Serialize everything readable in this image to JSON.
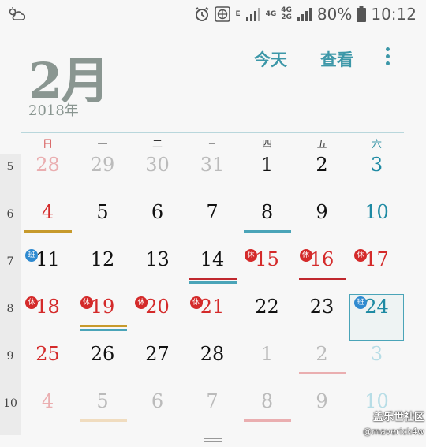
{
  "status_bar": {
    "network_e": "E",
    "network_4g": "4G",
    "network_4g_2g_top": "4G",
    "network_4g_2g_bottom": "2G",
    "battery": "80%",
    "time": "10:12"
  },
  "header": {
    "month": "2月",
    "year": "2018年",
    "today_button": "今天",
    "view_button": "查看"
  },
  "weekdays": [
    "日",
    "一",
    "二",
    "三",
    "四",
    "五",
    "六"
  ],
  "week_numbers": [
    "5",
    "6",
    "7",
    "8",
    "9",
    "10"
  ],
  "weeks": [
    [
      {
        "d": "28",
        "c": "pink"
      },
      {
        "d": "29",
        "c": "dim"
      },
      {
        "d": "30",
        "c": "dim"
      },
      {
        "d": "31",
        "c": "dim"
      },
      {
        "d": "1",
        "c": "normal"
      },
      {
        "d": "2",
        "c": "normal"
      },
      {
        "d": "3",
        "c": "sat"
      }
    ],
    [
      {
        "d": "4",
        "c": "holiday",
        "u": [
          "#c79a2c"
        ]
      },
      {
        "d": "5",
        "c": "normal"
      },
      {
        "d": "6",
        "c": "normal"
      },
      {
        "d": "7",
        "c": "normal"
      },
      {
        "d": "8",
        "c": "normal",
        "u": [
          "#4aa4b8"
        ]
      },
      {
        "d": "9",
        "c": "normal"
      },
      {
        "d": "10",
        "c": "sat"
      }
    ],
    [
      {
        "d": "11",
        "c": "normal",
        "b": "班",
        "bt": "work"
      },
      {
        "d": "12",
        "c": "normal"
      },
      {
        "d": "13",
        "c": "normal"
      },
      {
        "d": "14",
        "c": "normal",
        "u": [
          "#c0282e",
          "#4aa4b8"
        ]
      },
      {
        "d": "15",
        "c": "holiday",
        "b": "休",
        "bt": "rest"
      },
      {
        "d": "16",
        "c": "holiday",
        "b": "休",
        "bt": "rest",
        "u": [
          "#c0282e"
        ]
      },
      {
        "d": "17",
        "c": "holiday",
        "b": "休",
        "bt": "rest"
      }
    ],
    [
      {
        "d": "18",
        "c": "holiday",
        "b": "休",
        "bt": "rest"
      },
      {
        "d": "19",
        "c": "holiday",
        "b": "休",
        "bt": "rest",
        "u": [
          "#c79a2c",
          "#4aa4b8"
        ]
      },
      {
        "d": "20",
        "c": "holiday",
        "b": "休",
        "bt": "rest"
      },
      {
        "d": "21",
        "c": "holiday",
        "b": "休",
        "bt": "rest"
      },
      {
        "d": "22",
        "c": "normal"
      },
      {
        "d": "23",
        "c": "normal"
      },
      {
        "d": "24",
        "c": "sat",
        "b": "班",
        "bt": "work",
        "today": true
      }
    ],
    [
      {
        "d": "25",
        "c": "holiday"
      },
      {
        "d": "26",
        "c": "normal"
      },
      {
        "d": "27",
        "c": "normal"
      },
      {
        "d": "28",
        "c": "normal"
      },
      {
        "d": "1",
        "c": "dim"
      },
      {
        "d": "2",
        "c": "dim",
        "u": [
          "#eaaeb0"
        ]
      },
      {
        "d": "3",
        "c": "sat-dim"
      }
    ],
    [
      {
        "d": "4",
        "c": "pink"
      },
      {
        "d": "5",
        "c": "dim",
        "u": [
          "#f0dcbf"
        ]
      },
      {
        "d": "6",
        "c": "dim"
      },
      {
        "d": "7",
        "c": "dim"
      },
      {
        "d": "8",
        "c": "dim",
        "u": [
          "#eaaeb0"
        ]
      },
      {
        "d": "9",
        "c": "dim"
      },
      {
        "d": "10",
        "c": "sat-dim"
      }
    ]
  ],
  "watermark": {
    "site": "盖乐世社区",
    "user": "@maverick4w"
  }
}
